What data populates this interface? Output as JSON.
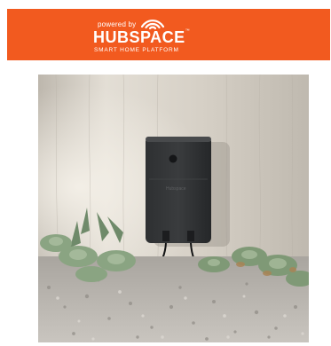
{
  "banner": {
    "powered_by": "powered by",
    "brand": "HUBSPACE",
    "trademark": "™",
    "tagline": "SMART HOME PLATFORM",
    "background_color": "#f25a1f",
    "icon": "wifi-signal-icon"
  },
  "product_image": {
    "device_label": "Hubspace"
  }
}
